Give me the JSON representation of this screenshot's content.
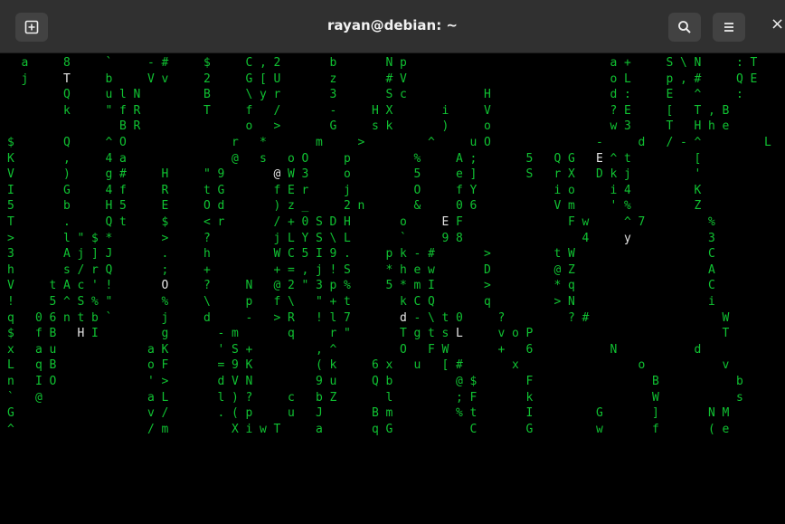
{
  "window": {
    "title": "rayan@debian: ~"
  },
  "terminal": {
    "rows": [
      "  a     8     `     - #     $     C , 2       b       N p                             a +     S \\ N     : T",
      "  j     T     b     V v     2     G [ U       z       # V                             o L     p , #     Q E",
      "        Q     u l N         B     \\ y r       3       S c           H                 d :     E   ^     :",
      "        k     \" f R         T     f   /       -     H X       i     V                 ? E     [   T , B",
      "                B R               o   >       G     s k       )     o                 w 3     T   H h e         .",
      "$       Q     ^ O               r   *       m     >         ^     u O               -     d   / - ^         L",
      "K       ,     4 a               @   s   o O     p         %     A ;       5   Q G   E ^ t         [",
      "V       )     g #     H     \" 9       @ W 3     o         5     e ]       S   r X   D k j         '",
      "I       G     4 f     R     t G       f E r     j         O     f Y           i o     i 4         K",
      "5       b     H 5     E     O d       ) z _     2 n       &     0 6           V m     ' %         Z",
      "T       .     Q t     $     < r       / + 0 S D H       o     E F               F w     ^ 7         %",
      ">       l \" $ *       >     ?         j L Y S \\ L       `     9 8                 4     y           3",
      "3       A j ] J       .     h         W C 5 I 9 .     p k - #       >         t W                   C",
      "h       s / r Q       ;     +         + = , j ! S     * h e w       D         @ Z                   A",
      "V     t A c ' !       O     ?     N   @ 2 \" 3 p %     5 * m I       >         * q                   C",
      "!     5 ^ S % \"       %     \\     p   f \\   \" + t       k C Q       q         > N                   i",
      "q   0 6 n t b `       j     d     -   > R   ! l 7       d - \\ t 0     ?         ? #                   W",
      "$   f B   H I         g       - m       q     r \"       T g t s L     v o P                           T",
      "x   a u             a K       ' S +         , ^         O   F W       +   6           N           d",
      "L   q B             o F       = 9 K         ( k     6 x   u   [ #       x                 o           v",
      "n   I O             ' >       d V N         9 u     Q b         @ $       F                 B           b",
      "`   @               a L       l ) ?     c   b Z       l         ; F       k                 W           s",
      "G                   v /       . ( p     u   J       B m         % t       I         G       ]       N M",
      "^                   / m         X i w T     a       q G           C       G         w       f       ( e"
    ]
  },
  "colors": {
    "matrix_green": "#10c232",
    "white_glyph": "#e6e6e6",
    "titlebar_bg": "#303030",
    "terminal_bg": "#000000"
  }
}
